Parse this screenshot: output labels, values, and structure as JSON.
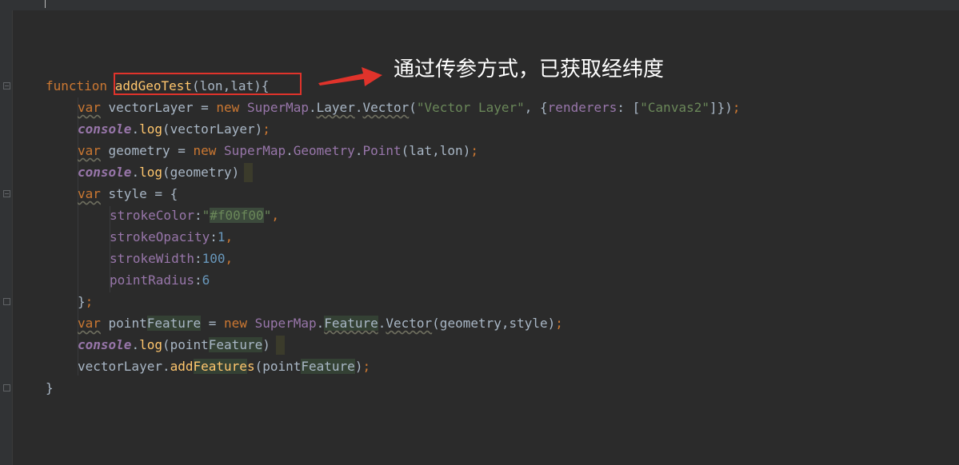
{
  "editor": {
    "theme_bg": "#2b2b2b",
    "gutter_bg": "#313335",
    "colors": {
      "keyword": "#cc7832",
      "function": "#ffc66d",
      "string": "#6a8759",
      "number": "#6897bb",
      "property": "#9876aa",
      "text": "#a9b7c6"
    }
  },
  "code": {
    "l1": {
      "kw": "function",
      "sp": " ",
      "fname": "addGeoTest",
      "rest": "(lon,lat){"
    },
    "l2": {
      "kw": "var",
      "t1": " vectorLayer = ",
      "kw2": "new",
      "sp": " ",
      "c1": "SuperMap",
      "d1": ".",
      "c2": "Layer",
      "d2": ".",
      "c3": "Vector",
      "p1": "(",
      "s1": "\"Vector Layer\"",
      "p2": ", {",
      "prop": "renderers",
      "p3": ": [",
      "s2": "\"Canvas2\"",
      "p4": "]})",
      "semi": ";"
    },
    "l3": {
      "obj": "console",
      "d": ".",
      "fn": "log",
      "rest": "(vectorLayer)",
      "semi": ";"
    },
    "l4": {
      "kw": "var",
      "t1": " geometry = ",
      "kw2": "new",
      "sp": " ",
      "c1": "SuperMap",
      "d1": ".",
      "c2": "Geometry",
      "d2": ".",
      "c3": "Point",
      "rest": "(lat,lon)",
      "semi": ";"
    },
    "l5": {
      "obj": "console",
      "d": ".",
      "fn": "log",
      "rest": "(geometry)",
      "paren": ")"
    },
    "l6": {
      "kw": "var",
      "rest": " style = {"
    },
    "l7": {
      "prop": "strokeColor",
      "colon": ":",
      "q1": "\"",
      "color": "#f00f00",
      "q2": "\"",
      "comma": ","
    },
    "l8": {
      "prop": "strokeOpacity",
      "colon": ":",
      "num": "1",
      "comma": ","
    },
    "l9": {
      "prop": "strokeWidth",
      "colon": ":",
      "num": "100",
      "comma": ","
    },
    "l10": {
      "prop": "pointRadius",
      "colon": ":",
      "num": "6"
    },
    "l11": {
      "text": "}",
      "semi": ";"
    },
    "l12": {
      "kw": "var",
      "t1": " point",
      "hl1": "Feature",
      "t2": " = ",
      "kw2": "new",
      "sp": " ",
      "c1": "SuperMap",
      "d1": ".",
      "c2": "Feature",
      "d2": ".",
      "c3": "Vector",
      "rest": "(geometry,style)",
      "semi": ";"
    },
    "l13": {
      "obj": "console",
      "d": ".",
      "fn": "log",
      "t1": "(point",
      "hl1": "Feature",
      "paren": ")"
    },
    "l14": {
      "t1": "vectorLayer.",
      "fn": "add",
      "hl1": "Feature",
      "fn2": "s",
      "t2": "(point",
      "hl2": "Feature",
      "t3": ")",
      "semi": ";"
    },
    "l15": {
      "text": "}"
    }
  },
  "annotation": {
    "text": "通过传参方式，已获取经纬度",
    "color": "#e0332b"
  }
}
